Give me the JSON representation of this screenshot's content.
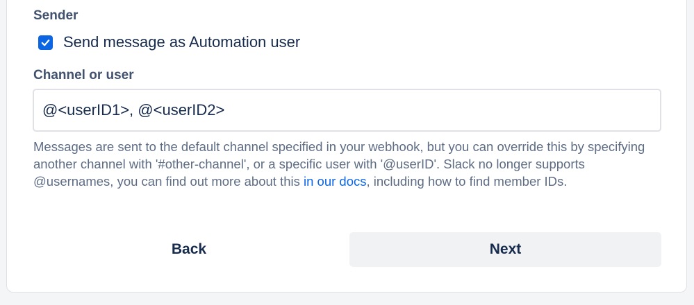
{
  "sender": {
    "heading": "Sender",
    "checkbox_label": "Send message as Automation user",
    "checkbox_checked": true,
    "accent_color": "#0c66e4"
  },
  "channel": {
    "heading": "Channel or user",
    "input_value": "@<userID1>, @<userID2>",
    "help_before_link": "Messages are sent to the default channel specified in your webhook, but you can override this by specifying another channel with '#other-channel', or a specific user with '@userID'. Slack no longer supports @usernames, you can find out more about this ",
    "help_link_text": "in our docs",
    "help_after_link": ", including how to find member IDs."
  },
  "actions": {
    "back_label": "Back",
    "next_label": "Next"
  },
  "icons": {
    "checkbox": "checkmark-icon"
  }
}
